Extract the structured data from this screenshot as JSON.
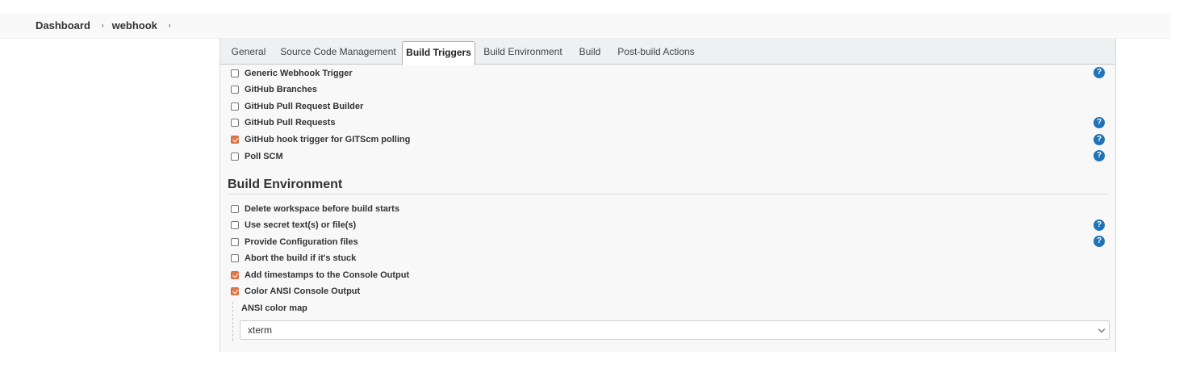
{
  "breadcrumb": {
    "items": [
      "Dashboard",
      "webhook"
    ],
    "separator": "›"
  },
  "tabs": [
    {
      "label": "General",
      "active": false
    },
    {
      "label": "Source Code Management",
      "active": false
    },
    {
      "label": "Build Triggers",
      "active": true
    },
    {
      "label": "Build Environment",
      "active": false
    },
    {
      "label": "Build",
      "active": false
    },
    {
      "label": "Post-build Actions",
      "active": false
    }
  ],
  "build_triggers": [
    {
      "label": "Generic Webhook Trigger",
      "checked": false,
      "help": true
    },
    {
      "label": "GitHub Branches",
      "checked": false,
      "help": false
    },
    {
      "label": "GitHub Pull Request Builder",
      "checked": false,
      "help": false
    },
    {
      "label": "GitHub Pull Requests",
      "checked": false,
      "help": true
    },
    {
      "label": "GitHub hook trigger for GITScm polling",
      "checked": true,
      "help": true
    },
    {
      "label": "Poll SCM",
      "checked": false,
      "help": true
    }
  ],
  "build_environment": {
    "title": "Build Environment",
    "options": [
      {
        "label": "Delete workspace before build starts",
        "checked": false,
        "help": false
      },
      {
        "label": "Use secret text(s) or file(s)",
        "checked": false,
        "help": true
      },
      {
        "label": "Provide Configuration files",
        "checked": false,
        "help": true
      },
      {
        "label": "Abort the build if it's stuck",
        "checked": false,
        "help": false
      },
      {
        "label": "Add timestamps to the Console Output",
        "checked": true,
        "help": false
      },
      {
        "label": "Color ANSI Console Output",
        "checked": true,
        "help": false
      }
    ],
    "ansi_color_map": {
      "label": "ANSI color map",
      "value": "xterm"
    }
  },
  "icons": {
    "help": "question-mark-help-icon",
    "help_glyph": "?"
  },
  "colors": {
    "checkbox_checked": "#e0784a",
    "help_icon": "#1f74b7"
  }
}
